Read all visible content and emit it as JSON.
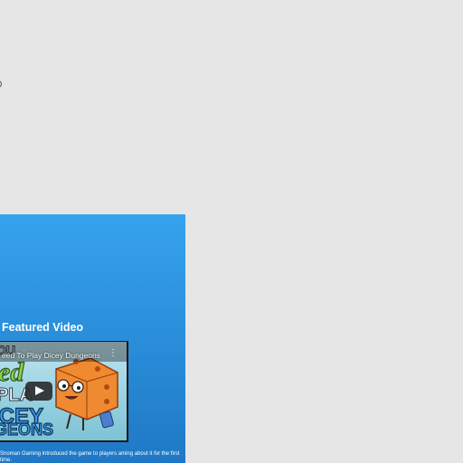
{
  "featured": {
    "heading": "Featured Video",
    "video": {
      "title": "eed To Play Dicey Dungeons",
      "menu_glyph": "⋮",
      "thumbnail_words": [
        "OU",
        "ed",
        "PLA",
        "ICEY",
        "GEONS"
      ]
    },
    "description": "Snoman Gaming introduced the game to players aming about it for the first time."
  },
  "colors": {
    "page_bg": "#e6e6e6",
    "panel_top": "#36a2ee",
    "panel_bottom": "#1f78c5",
    "thumb_bg": "#9fd3e0",
    "dice": "#f08a30"
  }
}
